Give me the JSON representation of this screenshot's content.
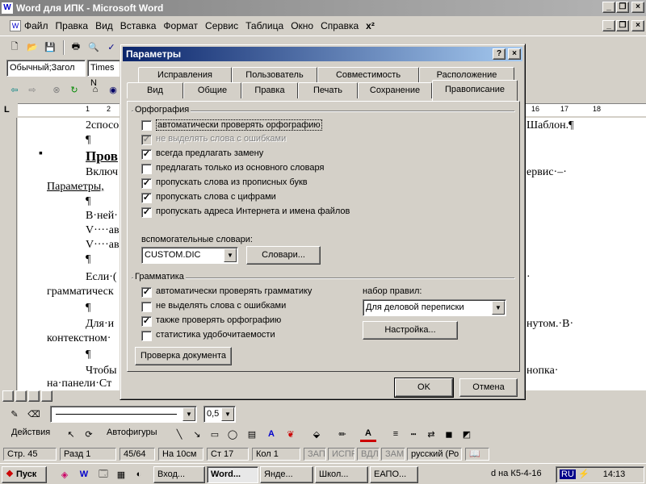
{
  "window": {
    "title": "Word для  ИПК - Microsoft Word"
  },
  "menu": [
    "Файл",
    "Правка",
    "Вид",
    "Вставка",
    "Формат",
    "Сервис",
    "Таблица",
    "Окно",
    "Справка",
    "x²"
  ],
  "format_bar": {
    "style": "Обычный;Загол",
    "font": "Times N"
  },
  "ruler": {
    "labels": [
      "1",
      "2",
      "16",
      "17",
      "18"
    ]
  },
  "document": {
    "lines": [
      "2спосо",
      "¶",
      "Пров",
      "Включ",
      "Параметры,",
      "¶",
      "В·ней·",
      "V····ав",
      "V····ав",
      "¶",
      "Если·(",
      "грамматическ",
      "¶",
      "Для·и",
      "контекстном·",
      "¶",
      "Чтобы",
      "на·панели·Ст"
    ],
    "right_lines": [
      "Шаблон.¶",
      "ервис·–·",
      "·",
      "нутом.·В·",
      "нопка·"
    ]
  },
  "dialog": {
    "title": "Параметры",
    "tabs_back": [
      "Исправления",
      "Пользователь",
      "Совместимость",
      "Расположение"
    ],
    "tabs_front": [
      "Вид",
      "Общие",
      "Правка",
      "Печать",
      "Сохранение",
      "Правописание"
    ],
    "active_tab": "Правописание",
    "spelling": {
      "group_label": "Орфография",
      "options": [
        {
          "label": "автоматически проверять орфографию",
          "checked": false,
          "disabled": false
        },
        {
          "label": "не выделять слова с ошибками",
          "checked": true,
          "disabled": true
        },
        {
          "label": "всегда предлагать замену",
          "checked": true,
          "disabled": false
        },
        {
          "label": "предлагать только из основного словаря",
          "checked": false,
          "disabled": false
        },
        {
          "label": "пропускать слова из прописных букв",
          "checked": true,
          "disabled": false
        },
        {
          "label": "пропускать слова с цифрами",
          "checked": true,
          "disabled": false
        },
        {
          "label": "пропускать адреса Интернета и имена файлов",
          "checked": true,
          "disabled": false
        }
      ],
      "dict_label": "вспомогательные словари:",
      "dict_value": "CUSTOM.DIC",
      "dict_button": "Словари..."
    },
    "grammar": {
      "group_label": "Грамматика",
      "options": [
        {
          "label": "автоматически проверять грамматику",
          "checked": true
        },
        {
          "label": "не выделять слова с ошибками",
          "checked": false
        },
        {
          "label": "также проверять орфографию",
          "checked": true
        },
        {
          "label": "статистика удобочитаемости",
          "checked": false
        }
      ],
      "rules_label": "набор правил:",
      "rules_value": "Для деловой переписки",
      "settings_button": "Настройка...",
      "check_doc_button": "Проверка документа"
    },
    "ok": "OK",
    "cancel": "Отмена"
  },
  "drawing_bar": {
    "line_width": "0,5",
    "actions": "Действия",
    "autoshapes": "Автофигуры"
  },
  "status": {
    "page": "Стр. 45",
    "section": "Разд 1",
    "pages": "45/64",
    "at": "На 10см",
    "line": "Ст 17",
    "col": "Кол 1",
    "rec": "ЗАП",
    "trk": "ИСПР",
    "ext": "ВДЛ",
    "ovr": "ЗАМ",
    "lang": "русский (Ро"
  },
  "taskbar": {
    "start": "Пуск",
    "tasks": [
      "Вход...",
      "Word...",
      "Янде...",
      "Школ...",
      "ЕАПО..."
    ],
    "drive": "d на К5-4-16",
    "lang": "RU",
    "time": "14:13"
  }
}
